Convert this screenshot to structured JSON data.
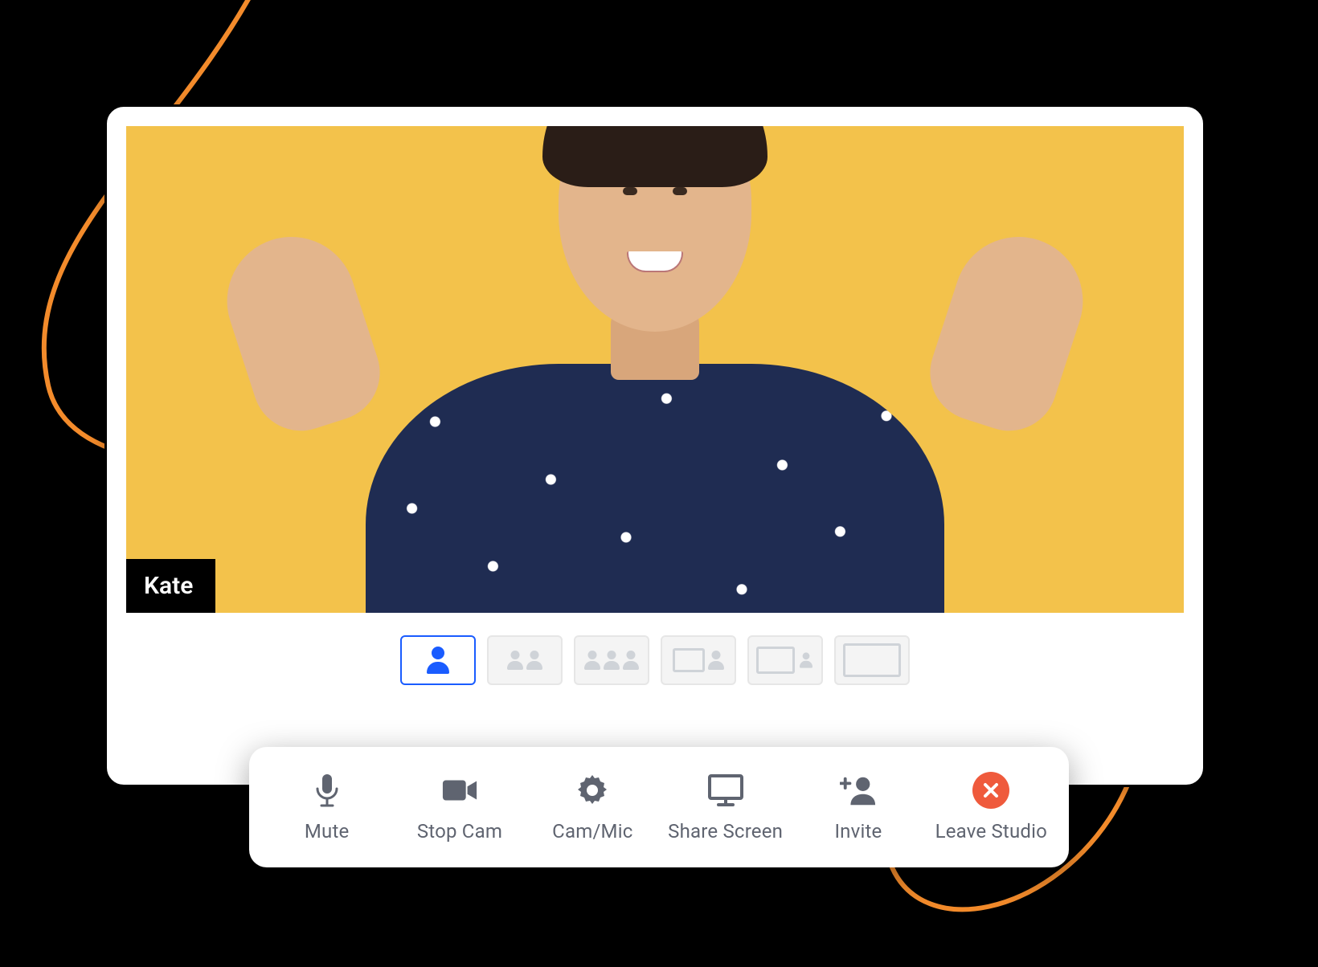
{
  "colors": {
    "video_bg": "#f3c24b",
    "accent": "#1a5cff",
    "leave": "#ef5a3c",
    "swoosh": "#f38b2b"
  },
  "participant": {
    "name": "Kate"
  },
  "layouts": {
    "items": [
      {
        "id": "single",
        "active": true
      },
      {
        "id": "two-up",
        "active": false
      },
      {
        "id": "three-up",
        "active": false
      },
      {
        "id": "screen-pip",
        "active": false
      },
      {
        "id": "screen-side",
        "active": false
      },
      {
        "id": "screen-full",
        "active": false
      }
    ]
  },
  "toolbar": {
    "mute_label": "Mute",
    "stop_cam_label": "Stop Cam",
    "cam_mic_label": "Cam/Mic",
    "share_screen_label": "Share Screen",
    "invite_label": "Invite",
    "leave_label": "Leave Studio"
  },
  "icons": {
    "mute": "microphone-icon",
    "stop_cam": "video-camera-icon",
    "cam_mic": "gear-icon",
    "share_screen": "monitor-icon",
    "invite": "user-plus-icon",
    "leave": "close-icon"
  }
}
